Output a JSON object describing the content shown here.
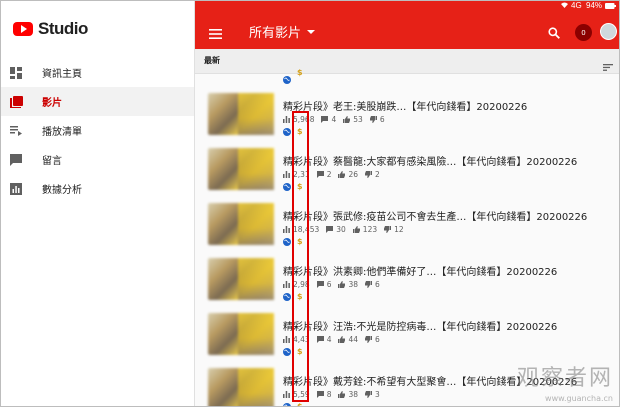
{
  "status_bar": {
    "signal": "4G",
    "battery": "94%"
  },
  "app": {
    "name": "Studio"
  },
  "sidebar": {
    "items": [
      {
        "label": "資訊主頁",
        "icon": "dashboard-icon"
      },
      {
        "label": "影片",
        "icon": "videos-icon",
        "active": true
      },
      {
        "label": "播放清單",
        "icon": "playlist-icon"
      },
      {
        "label": "留言",
        "icon": "comment-icon"
      },
      {
        "label": "數據分析",
        "icon": "analytics-icon"
      }
    ]
  },
  "header": {
    "title": "所有影片",
    "notifications": "0"
  },
  "sort": {
    "label": "最新"
  },
  "videos": [
    {
      "title": "精彩片段》老王:美股崩跌…【年代向錢看】20200226",
      "views": "5,968",
      "comments": "4",
      "likes": "53",
      "dislikes": "6"
    },
    {
      "title": "精彩片段》蔡醫龍:大家都有感染風險…【年代向錢看】20200226",
      "views": "2,31",
      "comments": "2",
      "likes": "26",
      "dislikes": "2"
    },
    {
      "title": "精彩片段》張武修:疫苗公司不會去生產…【年代向錢看】20200226",
      "views": "18,453",
      "comments": "30",
      "likes": "123",
      "dislikes": "12"
    },
    {
      "title": "精彩片段》洪素卿:他們準備好了…【年代向錢看】20200226",
      "views": "2,98",
      "comments": "6",
      "likes": "38",
      "dislikes": "6"
    },
    {
      "title": "精彩片段》汪浩:不光是防控病毒…【年代向錢看】20200226",
      "views": "4,43",
      "comments": "4",
      "likes": "44",
      "dislikes": "6"
    },
    {
      "title": "精彩片段》戴芳銓:不希望有大型聚會…【年代向錢看】20200226",
      "views": "5,59",
      "comments": "8",
      "likes": "38",
      "dislikes": "3"
    }
  ],
  "monetization_symbol": "$",
  "watermark": {
    "text": "观察者网",
    "sub": "www.guancha.cn"
  },
  "colors": {
    "brand_red": "#e62117",
    "monetization": "#d4a017",
    "highlight_box": "#e00000"
  }
}
